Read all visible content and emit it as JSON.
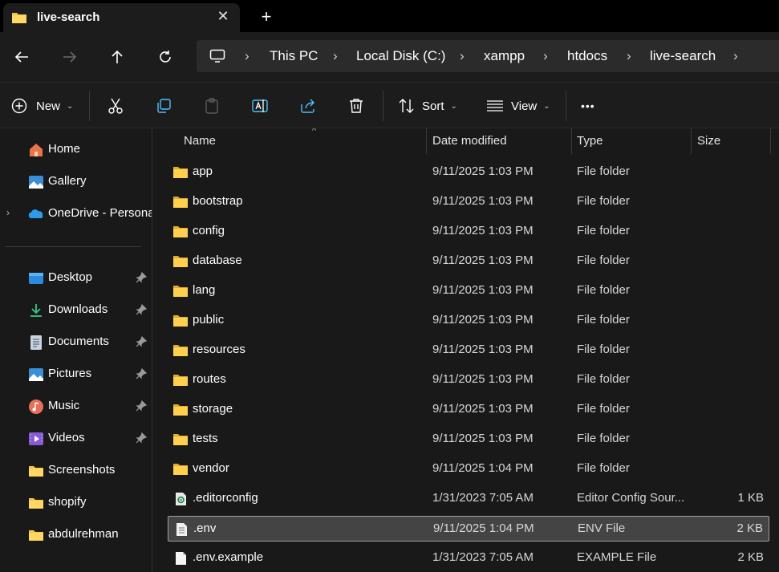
{
  "window": {
    "tab_title": "live-search",
    "close_symbol": "✕",
    "new_tab_symbol": "+"
  },
  "address": {
    "crumbs": [
      "This PC",
      "Local Disk (C:)",
      "xampp",
      "htdocs",
      "live-search"
    ],
    "separator": "›"
  },
  "toolbar": {
    "new_label": "New",
    "sort_label": "Sort",
    "view_label": "View",
    "more_label": "•••",
    "caret": "⌄"
  },
  "sidebar": {
    "expander": "›",
    "items": [
      {
        "label": "Home",
        "icon": "home-icon"
      },
      {
        "label": "Gallery",
        "icon": "gallery-icon"
      },
      {
        "label": "OneDrive - Persona",
        "icon": "onedrive-icon"
      },
      {
        "label": "Desktop",
        "icon": "desktop-icon",
        "pinned": true
      },
      {
        "label": "Downloads",
        "icon": "downloads-icon",
        "pinned": true
      },
      {
        "label": "Documents",
        "icon": "documents-icon",
        "pinned": true
      },
      {
        "label": "Pictures",
        "icon": "pictures-icon",
        "pinned": true
      },
      {
        "label": "Music",
        "icon": "music-icon",
        "pinned": true
      },
      {
        "label": "Videos",
        "icon": "videos-icon",
        "pinned": true
      },
      {
        "label": "Screenshots",
        "icon": "folder-icon"
      },
      {
        "label": "shopify",
        "icon": "folder-icon"
      },
      {
        "label": "abdulrehman",
        "icon": "folder-icon"
      }
    ]
  },
  "list": {
    "columns": {
      "name": "Name",
      "date": "Date modified",
      "type": "Type",
      "size": "Size"
    },
    "sort_indicator": "^",
    "rows": [
      {
        "name": "app",
        "date": "9/11/2025 1:03 PM",
        "type": "File folder",
        "size": "",
        "icon": "folder-icon"
      },
      {
        "name": "bootstrap",
        "date": "9/11/2025 1:03 PM",
        "type": "File folder",
        "size": "",
        "icon": "folder-icon"
      },
      {
        "name": "config",
        "date": "9/11/2025 1:03 PM",
        "type": "File folder",
        "size": "",
        "icon": "folder-icon"
      },
      {
        "name": "database",
        "date": "9/11/2025 1:03 PM",
        "type": "File folder",
        "size": "",
        "icon": "folder-icon"
      },
      {
        "name": "lang",
        "date": "9/11/2025 1:03 PM",
        "type": "File folder",
        "size": "",
        "icon": "folder-icon"
      },
      {
        "name": "public",
        "date": "9/11/2025 1:03 PM",
        "type": "File folder",
        "size": "",
        "icon": "folder-icon"
      },
      {
        "name": "resources",
        "date": "9/11/2025 1:03 PM",
        "type": "File folder",
        "size": "",
        "icon": "folder-icon"
      },
      {
        "name": "routes",
        "date": "9/11/2025 1:03 PM",
        "type": "File folder",
        "size": "",
        "icon": "folder-icon"
      },
      {
        "name": "storage",
        "date": "9/11/2025 1:03 PM",
        "type": "File folder",
        "size": "",
        "icon": "folder-icon"
      },
      {
        "name": "tests",
        "date": "9/11/2025 1:03 PM",
        "type": "File folder",
        "size": "",
        "icon": "folder-icon"
      },
      {
        "name": "vendor",
        "date": "9/11/2025 1:04 PM",
        "type": "File folder",
        "size": "",
        "icon": "folder-icon"
      },
      {
        "name": ".editorconfig",
        "date": "1/31/2023 7:05 AM",
        "type": "Editor Config Sour...",
        "size": "1 KB",
        "icon": "config-file-icon"
      },
      {
        "name": ".env",
        "date": "9/11/2025 1:04 PM",
        "type": "ENV File",
        "size": "2 KB",
        "icon": "text-file-icon",
        "selected": true
      },
      {
        "name": ".env.example",
        "date": "1/31/2023 7:05 AM",
        "type": "EXAMPLE File",
        "size": "2 KB",
        "icon": "file-icon"
      }
    ]
  },
  "colors": {
    "folder": "#f5c542",
    "accent": "#4cc2ff",
    "background": "#191919",
    "selected_row": "#444444"
  }
}
